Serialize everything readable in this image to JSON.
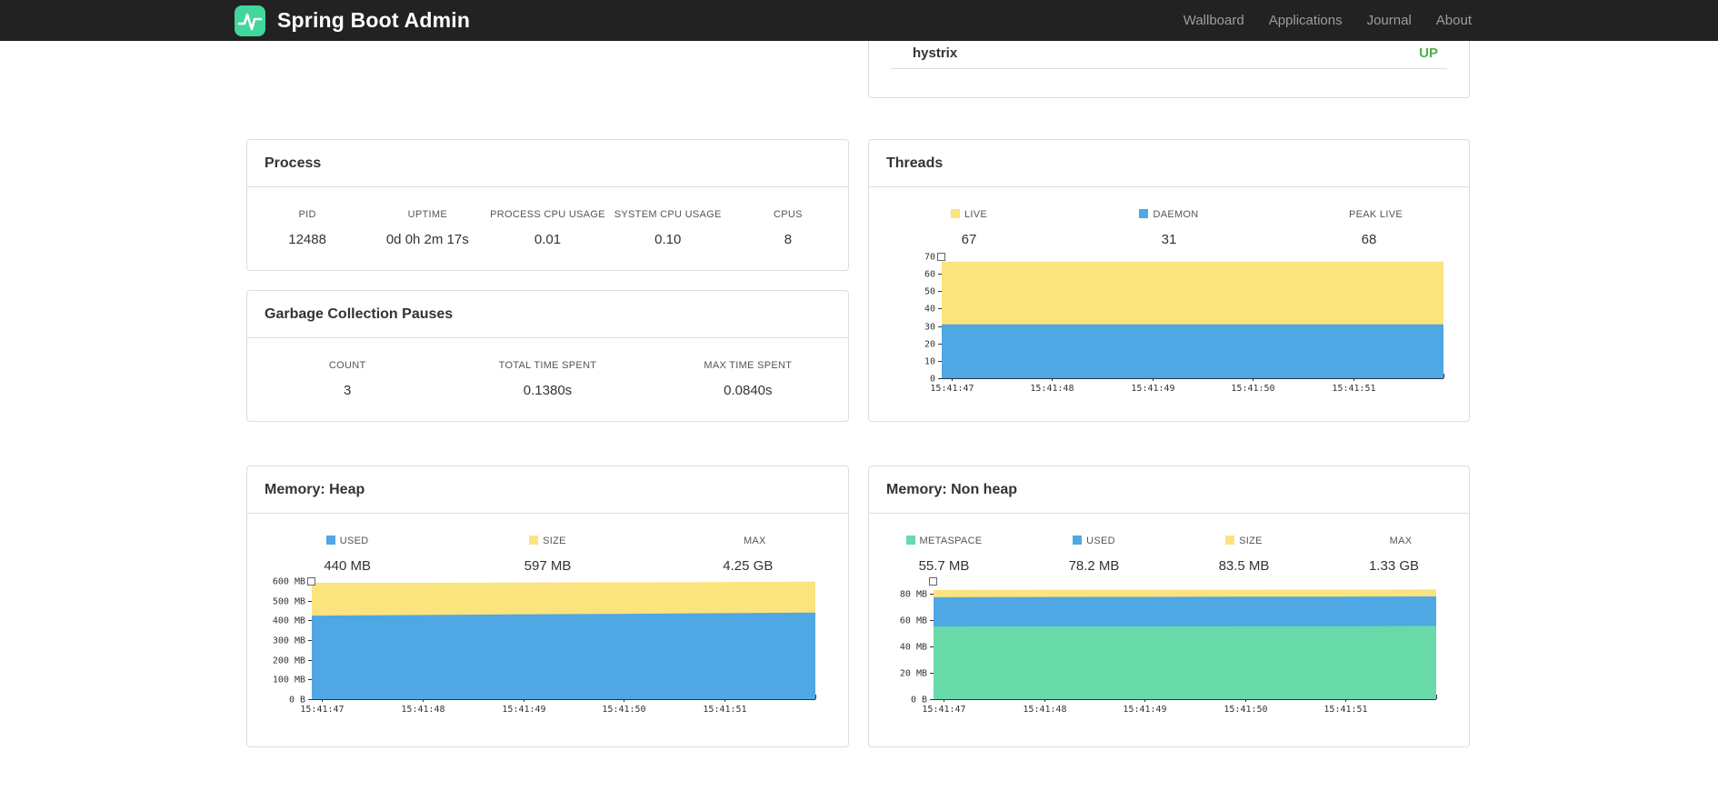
{
  "colors": {
    "brand_green": "#41d69b",
    "chart_yellow": "#fbe37d",
    "chart_blue": "#4fa7e3",
    "chart_green": "#68d9a9",
    "status_up": "#4caf50",
    "navbar_bg": "#222222"
  },
  "navbar": {
    "brand": "Spring Boot Admin",
    "links": [
      {
        "label": "Wallboard"
      },
      {
        "label": "Applications"
      },
      {
        "label": "Journal"
      },
      {
        "label": "About"
      }
    ]
  },
  "hystrix_panel": {
    "service": "hystrix",
    "status": "UP",
    "status_color": "#4caf50"
  },
  "process": {
    "title": "Process",
    "stats": [
      {
        "label": "PID",
        "value": "12488"
      },
      {
        "label": "UPTIME",
        "value": "0d 0h 2m 17s"
      },
      {
        "label": "PROCESS CPU USAGE",
        "value": "0.01"
      },
      {
        "label": "SYSTEM CPU USAGE",
        "value": "0.10"
      },
      {
        "label": "CPUS",
        "value": "8"
      }
    ]
  },
  "gc": {
    "title": "Garbage Collection Pauses",
    "stats": [
      {
        "label": "COUNT",
        "value": "3"
      },
      {
        "label": "TOTAL TIME SPENT",
        "value": "0.1380s"
      },
      {
        "label": "MAX TIME SPENT",
        "value": "0.0840s"
      }
    ]
  },
  "threads": {
    "title": "Threads",
    "legend": [
      {
        "label": "LIVE",
        "value": "67",
        "color": "#fbe37d"
      },
      {
        "label": "DAEMON",
        "value": "31",
        "color": "#4fa7e3"
      },
      {
        "label": "PEAK LIVE",
        "value": "68",
        "color": null
      }
    ]
  },
  "memory_heap": {
    "title": "Memory: Heap",
    "legend": [
      {
        "label": "USED",
        "value": "440 MB",
        "color": "#4fa7e3"
      },
      {
        "label": "SIZE",
        "value": "597 MB",
        "color": "#fbe37d"
      },
      {
        "label": "MAX",
        "value": "4.25 GB",
        "color": null
      }
    ]
  },
  "memory_nonheap": {
    "title": "Memory: Non heap",
    "legend": [
      {
        "label": "METASPACE",
        "value": "55.7 MB",
        "color": "#68d9a9"
      },
      {
        "label": "USED",
        "value": "78.2 MB",
        "color": "#4fa7e3"
      },
      {
        "label": "SIZE",
        "value": "83.5 MB",
        "color": "#fbe37d"
      },
      {
        "label": "MAX",
        "value": "1.33 GB",
        "color": null
      }
    ]
  },
  "chart_data": [
    {
      "id": "threads",
      "type": "area",
      "title": "Threads",
      "x": [
        "15:41:47",
        "15:41:48",
        "15:41:49",
        "15:41:50",
        "15:41:51"
      ],
      "ylim": [
        0,
        70
      ],
      "yticks": [
        {
          "v": 70,
          "label": "70"
        },
        {
          "v": 60,
          "label": "60"
        },
        {
          "v": 50,
          "label": "50"
        },
        {
          "v": 40,
          "label": "40"
        },
        {
          "v": 30,
          "label": "30"
        },
        {
          "v": 20,
          "label": "20"
        },
        {
          "v": 10,
          "label": "10"
        },
        {
          "v": 0,
          "label": "0"
        }
      ],
      "series": [
        {
          "name": "LIVE",
          "color": "#fbe37d",
          "values": [
            67,
            67,
            67,
            67,
            67,
            67
          ]
        },
        {
          "name": "DAEMON",
          "color": "#4fa7e3",
          "values": [
            31,
            31,
            31,
            31,
            31,
            31
          ]
        }
      ],
      "legend_position": "top",
      "grid": false
    },
    {
      "id": "memory-heap",
      "type": "area",
      "title": "Memory: Heap",
      "x": [
        "15:41:47",
        "15:41:48",
        "15:41:49",
        "15:41:50",
        "15:41:51"
      ],
      "ylim": [
        0,
        600
      ],
      "yticks": [
        {
          "v": 600,
          "label": "600 MB"
        },
        {
          "v": 500,
          "label": "500 MB"
        },
        {
          "v": 400,
          "label": "400 MB"
        },
        {
          "v": 300,
          "label": "300 MB"
        },
        {
          "v": 200,
          "label": "200 MB"
        },
        {
          "v": 100,
          "label": "100 MB"
        },
        {
          "v": 0,
          "label": "0 B"
        }
      ],
      "series": [
        {
          "name": "SIZE",
          "color": "#fbe37d",
          "values": [
            591,
            591,
            592,
            593,
            594,
            597
          ]
        },
        {
          "name": "USED",
          "color": "#4fa7e3",
          "values": [
            424,
            427,
            430,
            433,
            436,
            440
          ]
        }
      ],
      "legend_position": "top",
      "grid": false
    },
    {
      "id": "memory-nonheap",
      "type": "area",
      "title": "Memory: Non heap",
      "x": [
        "15:41:47",
        "15:41:48",
        "15:41:49",
        "15:41:50",
        "15:41:51"
      ],
      "ylim": [
        0,
        90
      ],
      "yticks": [
        {
          "v": 80,
          "label": "80 MB"
        },
        {
          "v": 60,
          "label": "60 MB"
        },
        {
          "v": 40,
          "label": "40 MB"
        },
        {
          "v": 20,
          "label": "20 MB"
        },
        {
          "v": 0,
          "label": "0 B"
        }
      ],
      "series": [
        {
          "name": "SIZE",
          "color": "#fbe37d",
          "values": [
            83.1,
            83.2,
            83.2,
            83.3,
            83.4,
            83.5
          ]
        },
        {
          "name": "USED",
          "color": "#4fa7e3",
          "values": [
            77.6,
            77.8,
            77.9,
            78.0,
            78.1,
            78.2
          ]
        },
        {
          "name": "METASPACE",
          "color": "#68d9a9",
          "values": [
            55.3,
            55.4,
            55.4,
            55.5,
            55.6,
            55.7
          ]
        }
      ],
      "legend_position": "top",
      "grid": false
    }
  ]
}
